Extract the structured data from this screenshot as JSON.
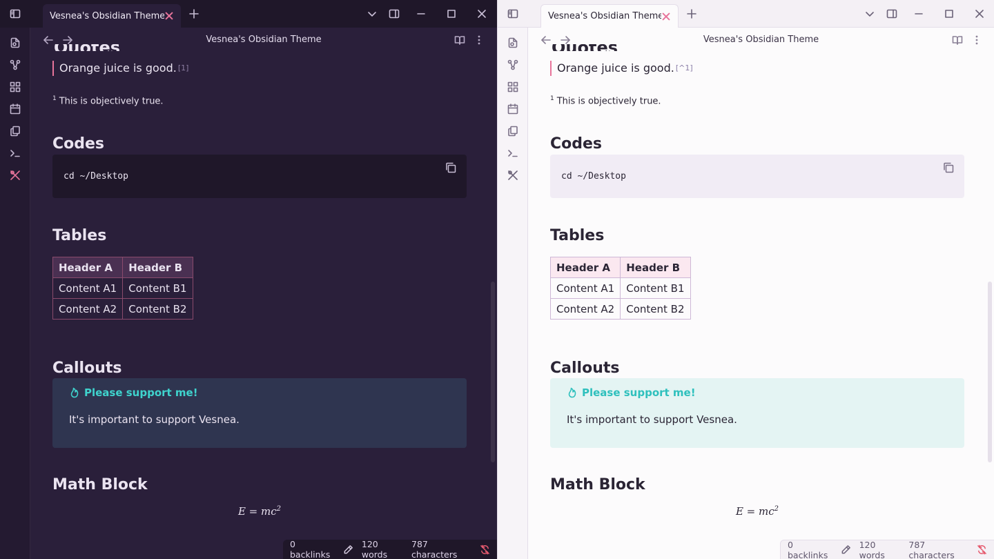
{
  "tab_title": "Vesnea's Obsidian Theme",
  "view_title": "Vesnea's Obsidian Theme",
  "partial_heading": "Quotes",
  "quote": {
    "text": "Orange juice is good.",
    "footnote_ref_dark": "[1]",
    "footnote_ref_light": "[^1]"
  },
  "footnote": {
    "number": "1",
    "text": "This is objectively true."
  },
  "codes": {
    "heading": "Codes",
    "code": "cd ~/Desktop"
  },
  "tables": {
    "heading": "Tables",
    "headers": [
      "Header A",
      "Header B"
    ],
    "rows": [
      [
        "Content A1",
        "Content B1"
      ],
      [
        "Content A2",
        "Content B2"
      ]
    ]
  },
  "callouts": {
    "heading": "Callouts",
    "title": "Please support me!",
    "body": "It's important to support Vesnea."
  },
  "math": {
    "heading": "Math Block",
    "formula": "E = mc",
    "exponent": "2"
  },
  "status": {
    "backlinks": "0 backlinks",
    "words": "120 words",
    "characters": "787 characters"
  },
  "colors": {
    "accent_pink": "#e8749b",
    "callout_teal": "#2fc0bd",
    "dark_bg": "#2a1f3a",
    "light_bg": "#fcfbfc"
  }
}
